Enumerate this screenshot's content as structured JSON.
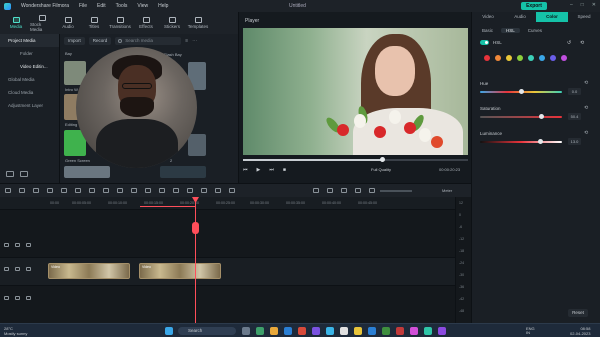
{
  "titlebar": {
    "app_name": "Wondershare Filmora",
    "menu": [
      "File",
      "Edit",
      "Tools",
      "View",
      "Help"
    ],
    "document": "Untitled",
    "export_label": "Export"
  },
  "toolbar": {
    "items": [
      "Media",
      "Stock Media",
      "Audio",
      "Titles",
      "Transitions",
      "Effects",
      "Stickers",
      "Templates"
    ]
  },
  "leftnav": {
    "items": [
      "Project Media",
      "Folder",
      "Video Editin...",
      "Global Media",
      "Cloud Media",
      "Adjustment Layer"
    ]
  },
  "media": {
    "import_label": "Import",
    "record_label": "Record",
    "search_placeholder": "Search media",
    "folder_label": "Bay",
    "thumb_labels": [
      "Intro W",
      "Editing",
      "Green Screen",
      "Flash Bay",
      "2"
    ]
  },
  "player": {
    "title": "Player",
    "quality": "Full Quality",
    "timecode": "00:00:20:23",
    "progress": 0.62
  },
  "properties": {
    "tabs": [
      "Video",
      "Audio",
      "Color",
      "Speed"
    ],
    "active_tab": "Color",
    "subtabs": [
      "Basic",
      "HSL",
      "Curves"
    ],
    "active_subtab": "HSL",
    "hsl_label": "HSL",
    "swatch_colors": [
      "#e8333b",
      "#f0883a",
      "#e9c739",
      "#8ccf3c",
      "#3cd0b8",
      "#3aa7e8",
      "#6a5ee8",
      "#c14fe0"
    ],
    "sliders": [
      {
        "label": "Hue",
        "value": "0.0",
        "fraction": 0.5
      },
      {
        "label": "Saturation",
        "value": "50.4",
        "fraction": 0.75
      },
      {
        "label": "Luminance",
        "value": "13.0",
        "fraction": 0.74
      }
    ],
    "reset_label": "Reset"
  },
  "timeline": {
    "meter_label": "Meter",
    "ruler": [
      "00:00",
      "00:00:05:00",
      "00:00:10:00",
      "00:00:15:00",
      "00:00:20:00",
      "00:00:25:00",
      "00:00:30:00",
      "00:00:35:00",
      "00:00:40:00",
      "00:00:45:00"
    ],
    "clips": [
      {
        "label": "Video"
      },
      {
        "label": "Video"
      }
    ],
    "meter_scale": [
      "12",
      "0",
      "-6",
      "-12",
      "-18",
      "-24",
      "-30",
      "-36",
      "-42",
      "-48"
    ]
  },
  "taskbar": {
    "weather_temp": "28°C",
    "weather_desc": "Mostly sunny",
    "search_label": "Search",
    "lang": "ENG",
    "region": "IN",
    "time": "08:58",
    "date": "02-04-2023"
  }
}
